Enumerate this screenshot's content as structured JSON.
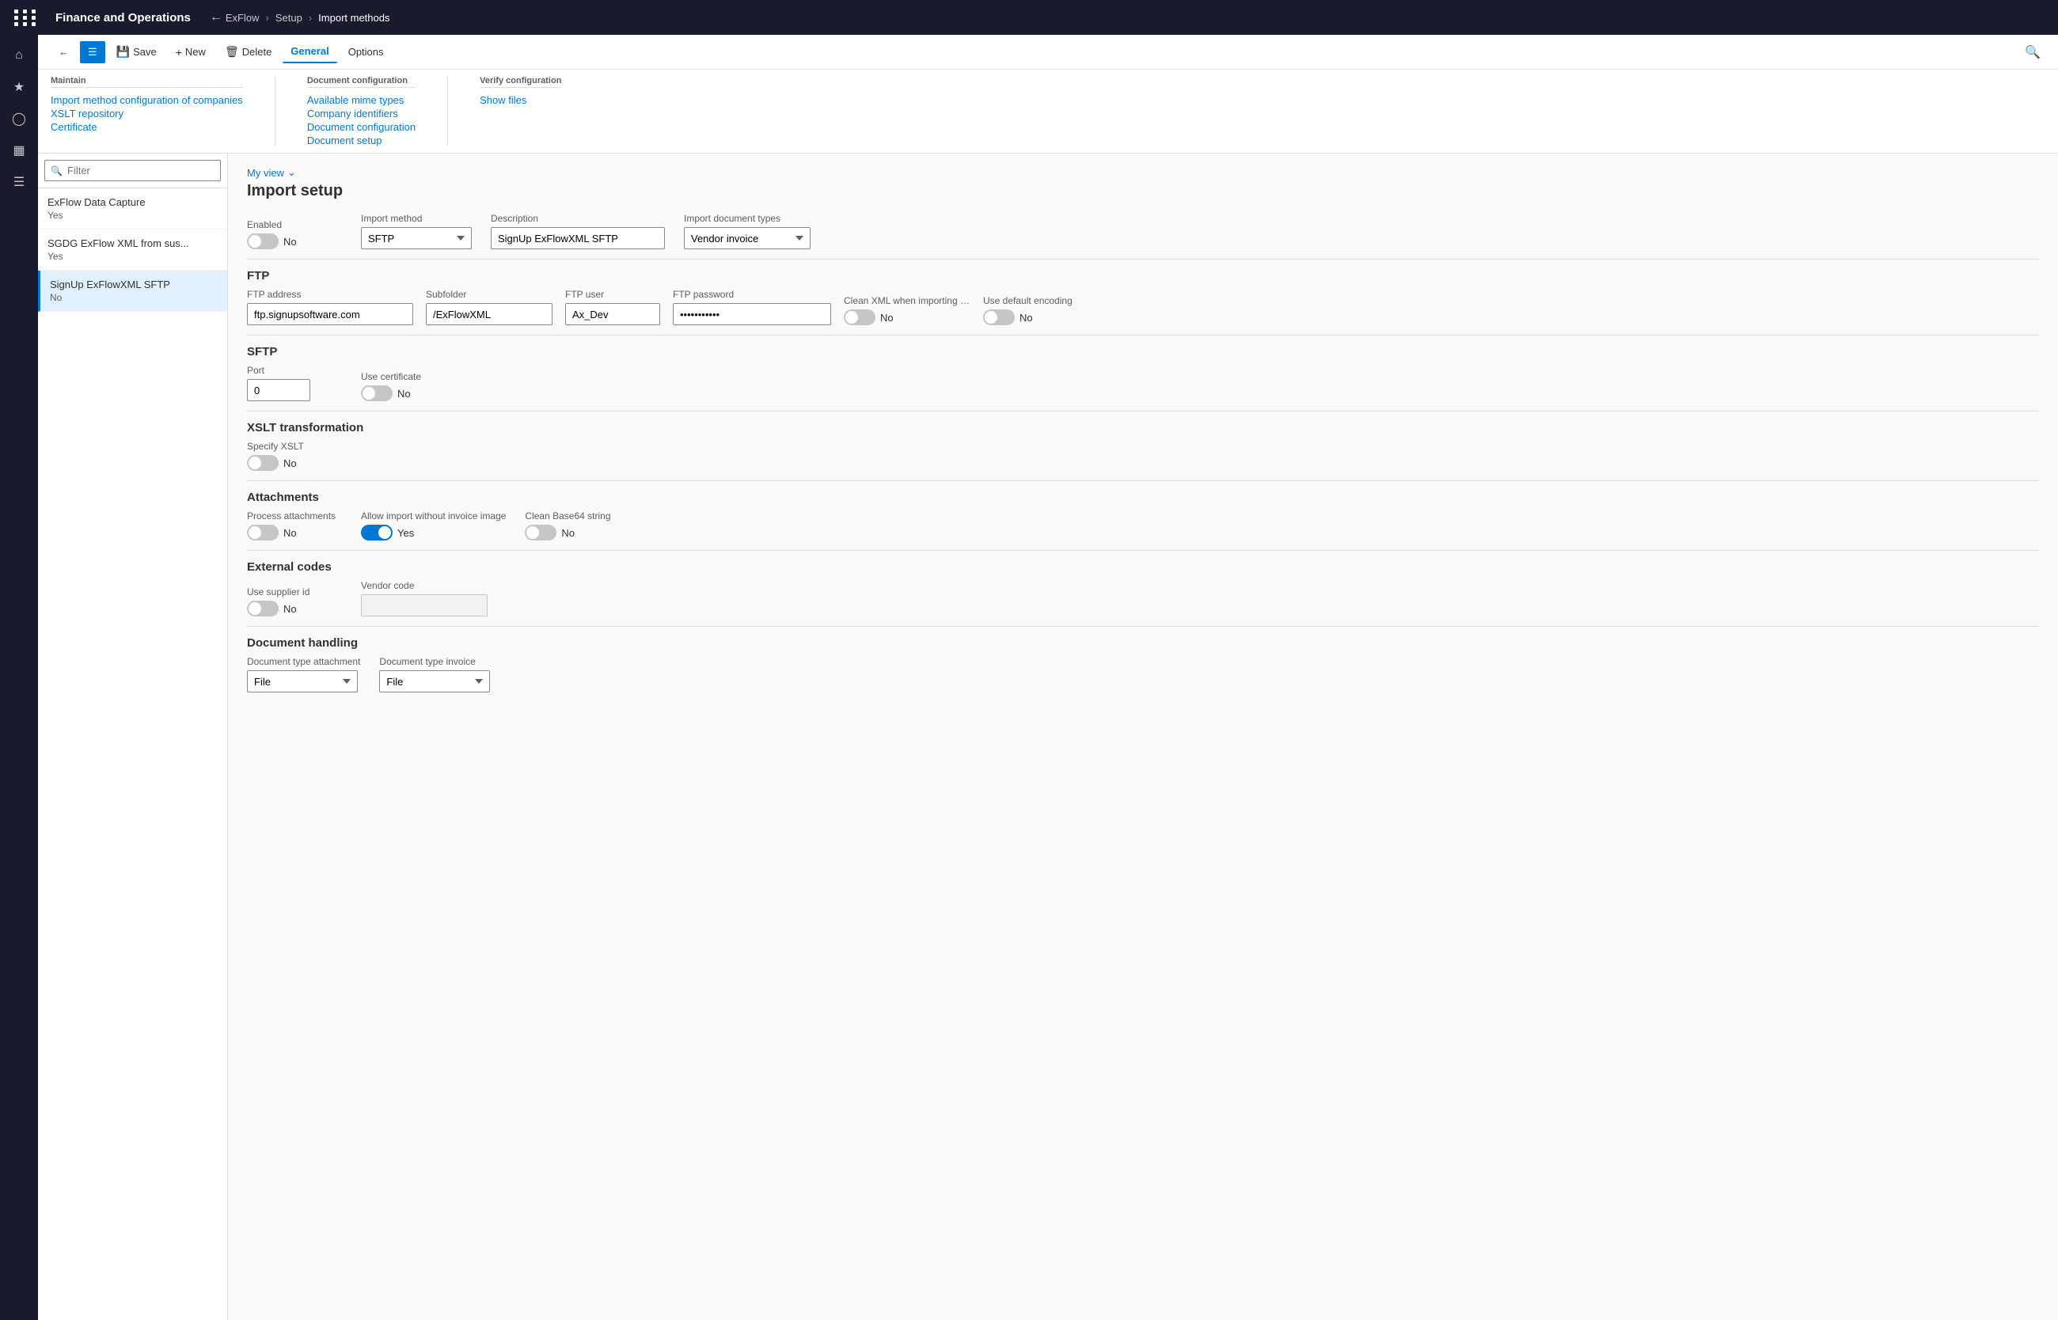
{
  "topbar": {
    "app_title": "Finance and Operations",
    "breadcrumbs": [
      "ExFlow",
      "Setup",
      "Import methods"
    ]
  },
  "actionbar": {
    "save_label": "Save",
    "new_label": "New",
    "delete_label": "Delete",
    "general_label": "General",
    "options_label": "Options"
  },
  "ribbon": {
    "maintain_label": "Maintain",
    "maintain_links": [
      "Import method configuration of companies",
      "XSLT repository",
      "Certificate"
    ],
    "doc_config_label": "Document configuration",
    "doc_config_links": [
      "Available mime types",
      "Company identifiers",
      "Document configuration",
      "Document setup"
    ],
    "verify_label": "Verify configuration",
    "verify_links": [
      "Show files"
    ]
  },
  "list": {
    "filter_placeholder": "Filter",
    "items": [
      {
        "title": "ExFlow Data Capture",
        "sub": "Yes",
        "selected": false
      },
      {
        "title": "SGDG ExFlow XML from sus...",
        "sub": "Yes",
        "selected": false
      },
      {
        "title": "SignUp ExFlowXML SFTP",
        "sub": "No",
        "selected": true
      }
    ]
  },
  "detail": {
    "myview_label": "My view",
    "page_title": "Import setup",
    "enabled_label": "Enabled",
    "enabled_value": "No",
    "enabled_on": false,
    "import_method_label": "Import method",
    "import_method_value": "SFTP",
    "description_label": "Description",
    "description_value": "SignUp ExFlowXML SFTP",
    "import_doc_types_label": "Import document types",
    "import_doc_types_value": "Vendor invoice",
    "ftp_section": "FTP",
    "ftp_address_label": "FTP address",
    "ftp_address_value": "ftp.signupsoftware.com",
    "subfolder_label": "Subfolder",
    "subfolder_value": "/ExFlowXML",
    "ftp_user_label": "FTP user",
    "ftp_user_value": "Ax_Dev",
    "ftp_password_label": "FTP password",
    "ftp_password_value": "••••••••••",
    "clean_xml_label": "Clean XML when importing using FTP/...",
    "clean_xml_value": "No",
    "clean_xml_on": false,
    "use_default_label": "Use default encoding",
    "use_default_value": "No",
    "use_default_on": false,
    "sftp_section": "SFTP",
    "port_label": "Port",
    "port_value": "0",
    "use_cert_label": "Use certificate",
    "use_cert_value": "No",
    "use_cert_on": false,
    "xslt_section": "XSLT transformation",
    "specify_xslt_label": "Specify XSLT",
    "specify_xslt_value": "No",
    "specify_xslt_on": false,
    "attachments_section": "Attachments",
    "process_attach_label": "Process attachments",
    "process_attach_value": "No",
    "process_attach_on": false,
    "allow_import_label": "Allow import without invoice image",
    "allow_import_value": "Yes",
    "allow_import_on": true,
    "clean_base64_label": "Clean Base64 string",
    "clean_base64_value": "No",
    "clean_base64_on": false,
    "ext_codes_section": "External codes",
    "use_supplier_label": "Use supplier id",
    "use_supplier_value": "No",
    "use_supplier_on": false,
    "vendor_code_label": "Vendor code",
    "vendor_code_value": "",
    "doc_handling_section": "Document handling",
    "doc_type_attach_label": "Document type attachment",
    "doc_type_attach_value": "File",
    "doc_type_invoice_label": "Document type invoice",
    "doc_type_invoice_value": "File"
  },
  "sidebar_icons": [
    {
      "name": "home",
      "symbol": "⌂"
    },
    {
      "name": "star",
      "symbol": "★"
    },
    {
      "name": "clock",
      "symbol": "🕐"
    },
    {
      "name": "monitor",
      "symbol": "🖥"
    },
    {
      "name": "list",
      "symbol": "≡"
    }
  ]
}
